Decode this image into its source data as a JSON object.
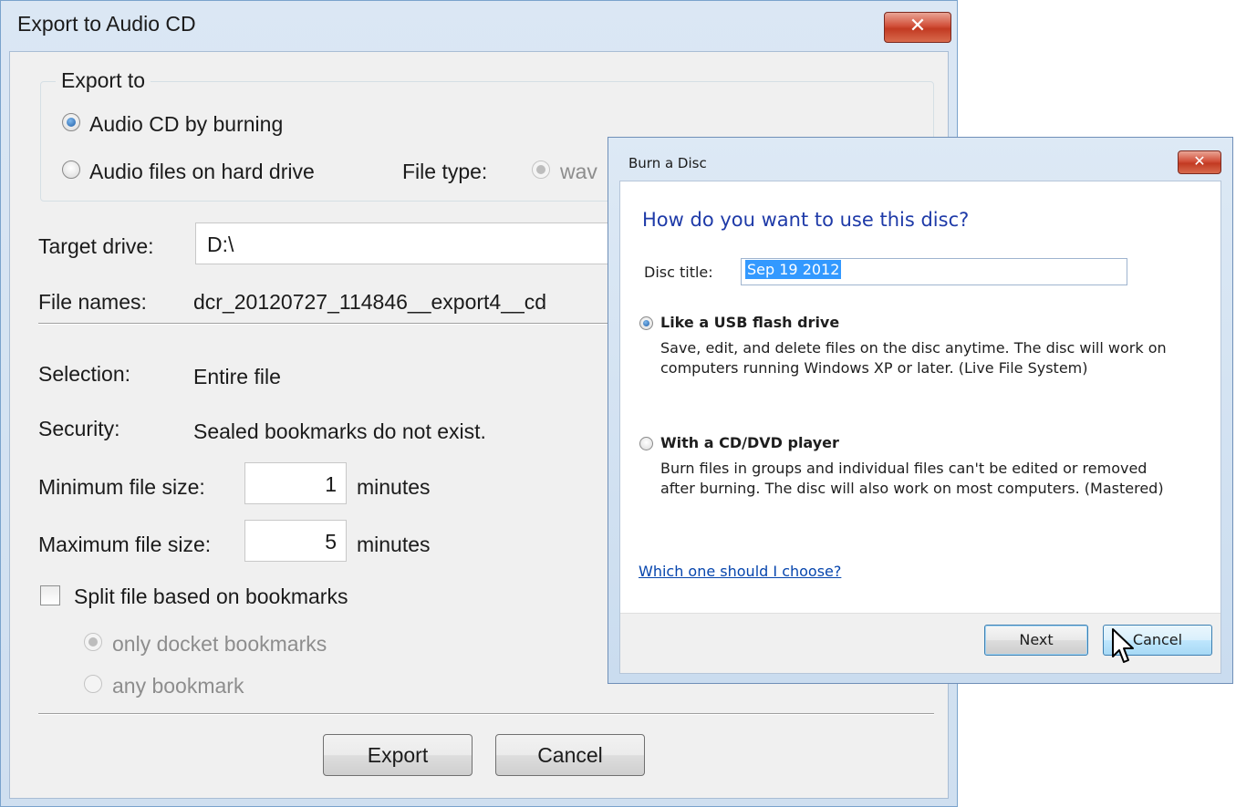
{
  "export_dialog": {
    "title": "Export to Audio CD",
    "close_glyph": "✕",
    "export_to": {
      "label": "Export to",
      "audio_cd": "Audio CD by burning",
      "audio_files": "Audio files on hard drive",
      "file_type_label": "File type:",
      "file_type_value": "wav"
    },
    "target_drive": {
      "label": "Target drive:",
      "value": "D:\\"
    },
    "file_names": {
      "label": "File names:",
      "value": "dcr_20120727_114846__export4__cd"
    },
    "selection": {
      "label": "Selection:",
      "value": "Entire file"
    },
    "security": {
      "label": "Security:",
      "value": "Sealed bookmarks do not exist."
    },
    "min_size": {
      "label": "Minimum file size:",
      "value": "1",
      "unit": "minutes"
    },
    "max_size": {
      "label": "Maximum file size:",
      "value": "5",
      "unit": "minutes"
    },
    "split": {
      "label": "Split file based on bookmarks",
      "only_docket": "only docket bookmarks",
      "any": "any bookmark"
    },
    "buttons": {
      "export": "Export",
      "cancel": "Cancel"
    }
  },
  "burn_dialog": {
    "title": "Burn a Disc",
    "close_glyph": "✕",
    "heading": "How do you want to use this disc?",
    "disc_title_label": "Disc title:",
    "disc_title_value": "Sep 19 2012",
    "option_usb": {
      "label": "Like a USB flash drive",
      "desc": "Save, edit, and delete files on the disc anytime. The disc will work on computers running Windows XP or later. (Live File System)"
    },
    "option_cd": {
      "label": "With a CD/DVD player",
      "desc": "Burn files in groups and individual files can't be edited or removed after burning. The disc will also work on most computers. (Mastered)"
    },
    "help_link": "Which one should I choose?",
    "buttons": {
      "next": "Next",
      "cancel": "Cancel"
    }
  },
  "colors": {
    "title_bar": "#cfdff0",
    "close_button": "#c23a22",
    "heading_blue": "#1e3aa8",
    "selection_blue": "#3399ff",
    "link_blue": "#0645ad"
  },
  "icons": [
    "close-icon",
    "radio-icon",
    "checkbox-icon",
    "mouse-pointer-icon"
  ]
}
